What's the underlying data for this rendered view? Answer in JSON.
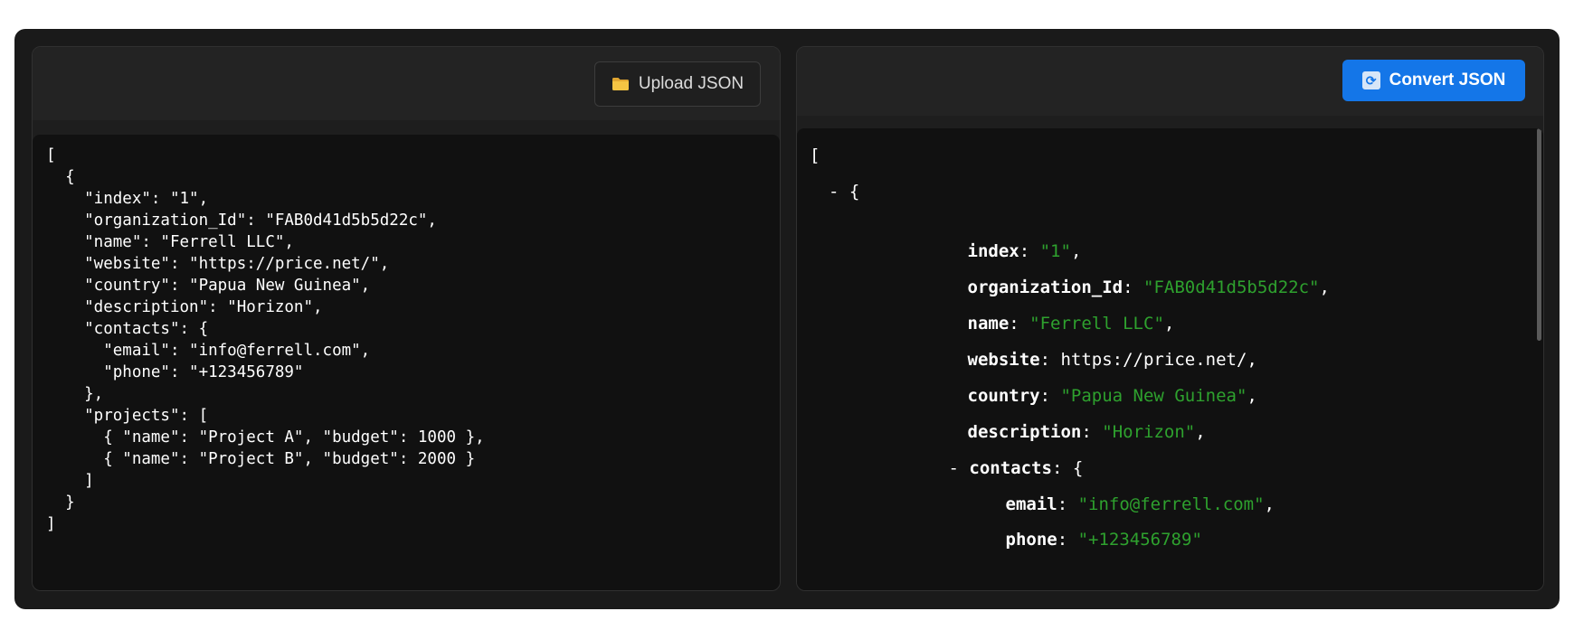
{
  "left_panel": {
    "upload_label": "Upload JSON",
    "source_text": "[\n  {\n    \"index\": \"1\",\n    \"organization_Id\": \"FAB0d41d5b5d22c\",\n    \"name\": \"Ferrell LLC\",\n    \"website\": \"https://price.net/\",\n    \"country\": \"Papua New Guinea\",\n    \"description\": \"Horizon\",\n    \"contacts\": {\n      \"email\": \"info@ferrell.com\",\n      \"phone\": \"+123456789\"\n    },\n    \"projects\": [\n      { \"name\": \"Project A\", \"budget\": 1000 },\n      { \"name\": \"Project B\", \"budget\": 2000 }\n    ]\n  }\n]"
  },
  "right_panel": {
    "convert_label": "Convert JSON",
    "tree": {
      "open_bracket": "[",
      "item_toggle": "- {",
      "fields": [
        {
          "key": "index",
          "value": "\"1\"",
          "suffix": ","
        },
        {
          "key": "organization_Id",
          "value": "\"FAB0d41d5b5d22c\"",
          "suffix": ","
        },
        {
          "key": "name",
          "value": "\"Ferrell LLC\"",
          "suffix": ","
        },
        {
          "key": "website",
          "value": "https://price.net/",
          "suffix": ","
        },
        {
          "key": "country",
          "value": "\"Papua New Guinea\"",
          "suffix": ","
        },
        {
          "key": "description",
          "value": "\"Horizon\"",
          "suffix": ","
        }
      ],
      "contacts_toggle": "-",
      "contacts_key": "contacts",
      "contacts_open": "{",
      "contacts": [
        {
          "key": "email",
          "value": "\"info@ferrell.com\"",
          "suffix": ","
        },
        {
          "key": "phone",
          "value": "\"+123456789\"",
          "suffix": ""
        }
      ]
    }
  },
  "colors": {
    "app_bg": "#1a1a1a",
    "editor_bg": "#111111",
    "accent": "#1476e8",
    "string_value": "#2ea12e"
  },
  "icons": {
    "upload": "folder-icon",
    "convert": "refresh-icon"
  }
}
